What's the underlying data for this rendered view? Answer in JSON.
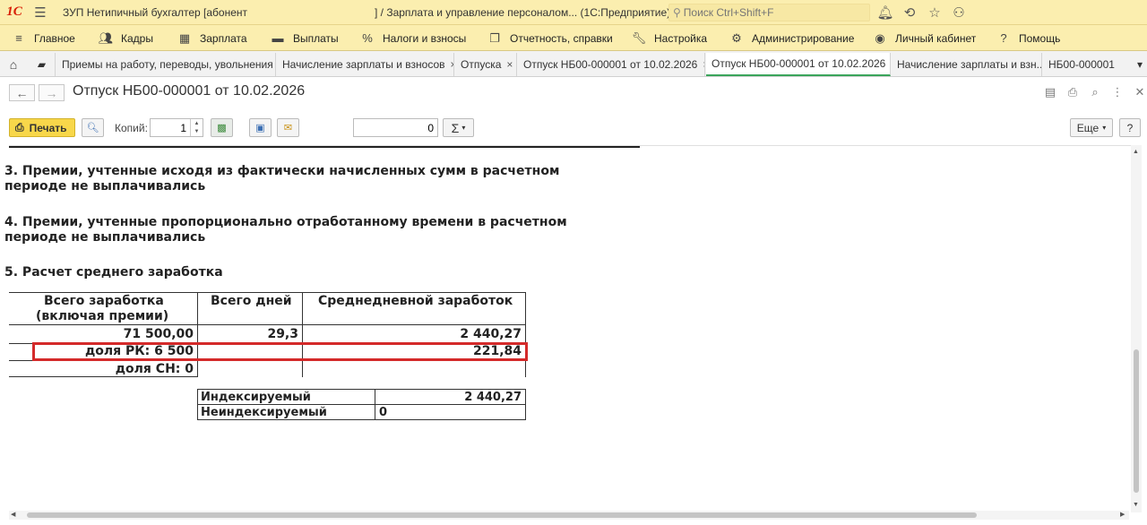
{
  "titlebar": {
    "logo": "1С",
    "title_left": "ЗУП Нетипичный бухгалтер [абонент",
    "title_right": "] / Зарплата и управление персоналом...  (1С:Предприятие)",
    "search_placeholder": "Поиск Ctrl+Shift+F"
  },
  "menu": [
    {
      "label": "Главное",
      "icon": "hamburger-icon"
    },
    {
      "label": "Кадры",
      "icon": "people-icon"
    },
    {
      "label": "Зарплата",
      "icon": "calculator-icon"
    },
    {
      "label": "Выплаты",
      "icon": "payments-icon"
    },
    {
      "label": "Налоги и взносы",
      "icon": "percent-icon"
    },
    {
      "label": "Отчетность, справки",
      "icon": "reports-icon"
    },
    {
      "label": "Настройка",
      "icon": "wrench-icon"
    },
    {
      "label": "Администрирование",
      "icon": "gear-icon"
    },
    {
      "label": "Личный кабинет",
      "icon": "user-icon"
    },
    {
      "label": "Помощь",
      "icon": "question-icon"
    }
  ],
  "tabs": [
    {
      "label": "Приемы на работу, переводы, увольнения",
      "close": "×"
    },
    {
      "label": "Начисление зарплаты и взносов",
      "close": "×"
    },
    {
      "label": "Отпуска",
      "close": "×"
    },
    {
      "label": "Отпуск НБ00-000001 от 10.02.2026",
      "close": "×"
    },
    {
      "label": "Отпуск НБ00-000001 от 10.02.2026",
      "close": "×",
      "active": true
    },
    {
      "label": "Начисление зарплаты и взн...",
      "close": ""
    },
    {
      "label": "НБ00-000001",
      "close": ""
    }
  ],
  "form": {
    "title": "Отпуск НБ00-000001 от 10.02.2026"
  },
  "toolbar": {
    "print_label": "Печать",
    "copies_label": "Копий:",
    "copies_value": "1",
    "sum_value": "0",
    "sum_symbol": "Σ",
    "more_label": "Еще",
    "help_label": "?"
  },
  "document": {
    "heading3_line1": "3. Премии, учтенные исходя из фактически начисленных сумм в расчетном",
    "heading3_line2": "периоде не выплачивались",
    "heading4_line1": "4. Премии, учтенные пропорционально отработанному времени в расчетном",
    "heading4_line2": "периоде не выплачивались",
    "heading5": "5. Расчет среднего  заработка",
    "table1": {
      "headers": [
        "Всего заработка",
        "(включая премии)",
        "Всего дней",
        "Среднедневной заработок"
      ],
      "rows": [
        [
          "71 500,00",
          "29,3",
          "2 440,27"
        ],
        [
          "доля РК: 6 500",
          "",
          "221,84"
        ],
        [
          "доля СН: 0",
          "",
          ""
        ]
      ]
    },
    "table2": {
      "rows": [
        [
          "Индексируемый",
          "2 440,27"
        ],
        [
          "Неиндексируемый",
          "0"
        ]
      ]
    }
  }
}
